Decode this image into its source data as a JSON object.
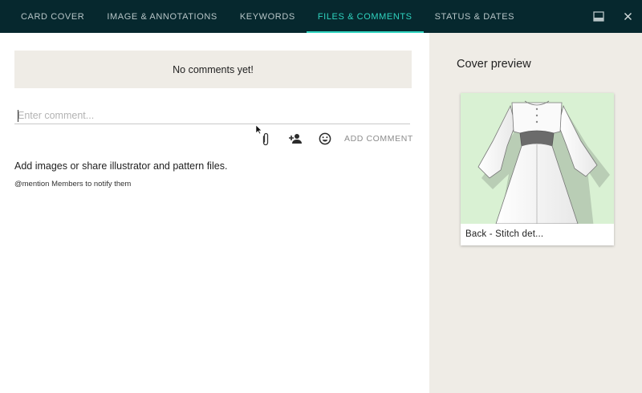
{
  "tabs": [
    {
      "label": "CARD COVER"
    },
    {
      "label": "IMAGE & ANNOTATIONS"
    },
    {
      "label": "KEYWORDS"
    },
    {
      "label": "FILES & COMMENTS",
      "active": true
    },
    {
      "label": "STATUS & DATES"
    }
  ],
  "top_icons": [
    "panel-toggle-icon",
    "close-icon"
  ],
  "comments": {
    "empty_message": "No comments yet!",
    "input_placeholder": "Enter comment...",
    "input_value": "",
    "add_comment_label": "ADD COMMENT",
    "action_icons": [
      "paperclip-icon",
      "add-person-icon",
      "emoji-icon"
    ]
  },
  "help": {
    "line1": "Add images or share illustrator and pattern files.",
    "line2": "@mention Members to notify them"
  },
  "cover": {
    "title": "Cover preview",
    "image_label": "Back - Stitch det..."
  },
  "colors": {
    "topbar": "#06282e",
    "accent": "#2fd3bf",
    "panel_bg": "#efece6",
    "cover_bg": "#d9f1d3"
  }
}
